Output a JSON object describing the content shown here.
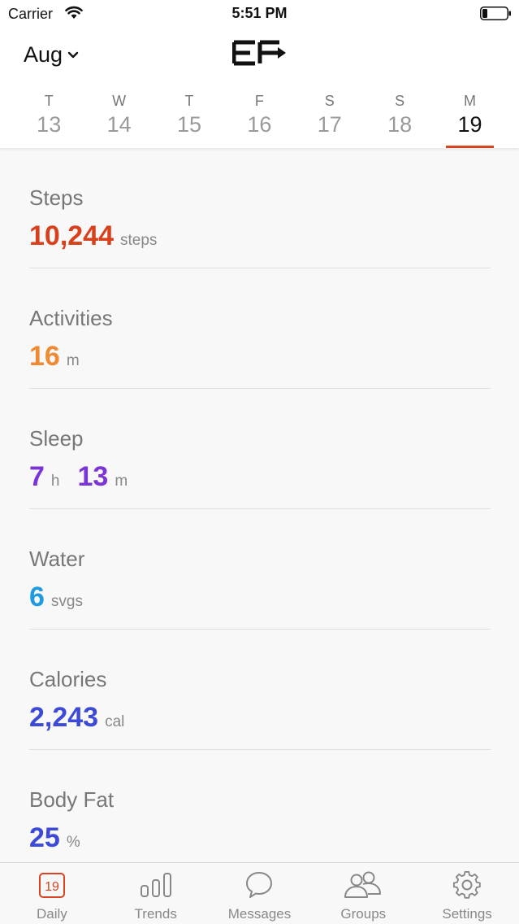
{
  "status_bar": {
    "carrier": "Carrier",
    "time": "5:51 PM"
  },
  "header": {
    "month": "Aug",
    "days": [
      {
        "letter": "T",
        "num": "13"
      },
      {
        "letter": "W",
        "num": "14"
      },
      {
        "letter": "T",
        "num": "15"
      },
      {
        "letter": "F",
        "num": "16"
      },
      {
        "letter": "S",
        "num": "17"
      },
      {
        "letter": "S",
        "num": "18"
      },
      {
        "letter": "M",
        "num": "19"
      }
    ]
  },
  "metrics": {
    "steps": {
      "title": "Steps",
      "value": "10,244",
      "unit": "steps",
      "color": "#d8401c"
    },
    "activities": {
      "title": "Activities",
      "value": "16",
      "unit": "m",
      "color": "#f08a32"
    },
    "sleep": {
      "title": "Sleep",
      "hours": "7",
      "hours_unit": "h",
      "minutes": "13",
      "minutes_unit": "m",
      "color": "#7b35d6"
    },
    "water": {
      "title": "Water",
      "value": "6",
      "unit": "svgs",
      "color": "#1d9ae0"
    },
    "calories": {
      "title": "Calories",
      "value": "2,243",
      "unit": "cal",
      "color": "#3d4ad8"
    },
    "body_fat": {
      "title": "Body Fat",
      "value": "25",
      "unit": "%",
      "color": "#3d4ad8"
    }
  },
  "tabbar": {
    "daily": {
      "label": "Daily",
      "badge": "19"
    },
    "trends": {
      "label": "Trends"
    },
    "messages": {
      "label": "Messages"
    },
    "groups": {
      "label": "Groups"
    },
    "settings": {
      "label": "Settings"
    }
  },
  "colors": {
    "accent": "#d9431f"
  }
}
